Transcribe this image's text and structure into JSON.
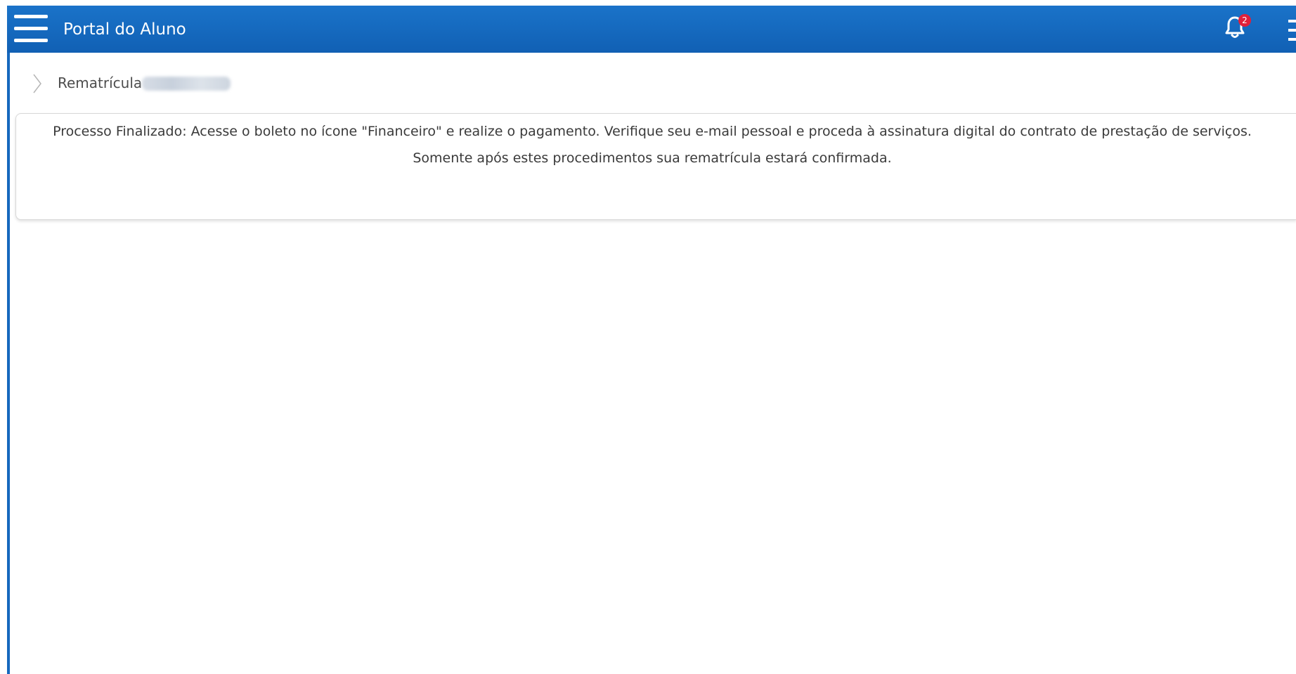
{
  "app": {
    "title": "Portal do Aluno",
    "notification_count": "2",
    "colors": {
      "header": "#1668bd",
      "badge": "#e0203a"
    }
  },
  "icons": {
    "menu": "hamburger-menu-icon",
    "notifications": "bell-icon",
    "more": "more-menu-icon",
    "breadcrumb": "chevron-right-icon"
  },
  "breadcrumb": {
    "label": "Rematrícula"
  },
  "notice": {
    "line1": "Processo Finalizado: Acesse o boleto no ícone \"Financeiro\" e realize o pagamento. Verifique seu e-mail pessoal e proceda à assinatura digital do contrato de prestação de serviços.",
    "line2": "Somente após estes procedimentos sua rematrícula estará confirmada."
  }
}
